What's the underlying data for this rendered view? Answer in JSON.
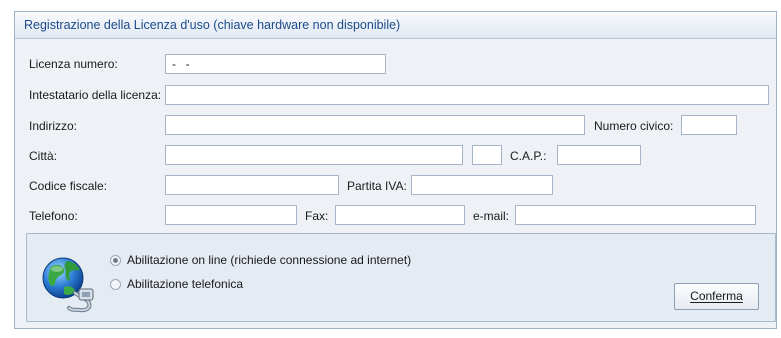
{
  "window": {
    "title": "Registrazione della Licenza d'uso (chiave hardware non disponibile)"
  },
  "form": {
    "license_number": {
      "label": "Licenza numero:",
      "value": "-  -"
    },
    "holder": {
      "label": "Intestatario della licenza:",
      "value": ""
    },
    "address": {
      "label": "Indirizzo:",
      "value": ""
    },
    "street_number": {
      "label": "Numero civico:",
      "value": ""
    },
    "city": {
      "label": "Città:",
      "value": ""
    },
    "province": {
      "value": ""
    },
    "postal_code": {
      "label": "C.A.P.:",
      "value": ""
    },
    "tax_code": {
      "label": "Codice fiscale:",
      "value": ""
    },
    "vat_number": {
      "label": "Partita IVA:",
      "value": ""
    },
    "phone": {
      "label": "Telefono:",
      "value": ""
    },
    "fax": {
      "label": "Fax:",
      "value": ""
    },
    "email": {
      "label": "e-mail:",
      "value": ""
    }
  },
  "activation": {
    "icon": "globe-network-icon",
    "options": [
      {
        "label": "Abilitazione on line (richiede connessione ad internet)",
        "selected": true
      },
      {
        "label": "Abilitazione telefonica",
        "selected": false
      }
    ],
    "confirm_label": "Conferma"
  }
}
